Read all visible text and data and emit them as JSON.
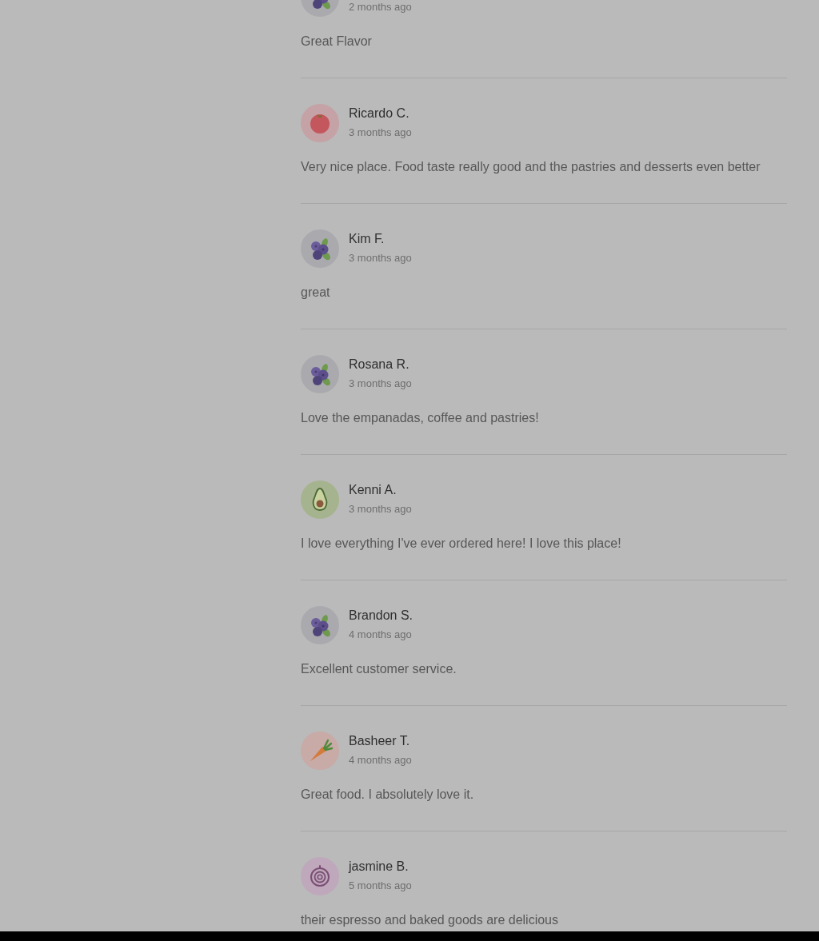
{
  "reviews": [
    {
      "avatar": {
        "kind": "blueberry"
      },
      "date": "2 months ago",
      "text": "Great Flavor"
    },
    {
      "avatar": {
        "kind": "tomato"
      },
      "name": "Ricardo C.",
      "date": "3 months ago",
      "text": "Very nice place. Food taste really good and the pastries and desserts even better"
    },
    {
      "avatar": {
        "kind": "blueberry"
      },
      "name": "Kim F.",
      "date": "3 months ago",
      "text": "great"
    },
    {
      "avatar": {
        "kind": "blueberry"
      },
      "name": "Rosana R.",
      "date": "3 months ago",
      "text": "Love the empanadas, coffee and pastries!"
    },
    {
      "avatar": {
        "kind": "avocado"
      },
      "name": "Kenni A.",
      "date": "3 months ago",
      "text": "I love everything I've ever ordered here! I love this place!"
    },
    {
      "avatar": {
        "kind": "blueberry"
      },
      "name": "Brandon S.",
      "date": "4 months ago",
      "text": "Excellent customer service."
    },
    {
      "avatar": {
        "kind": "carrot"
      },
      "name": "Basheer T.",
      "date": "4 months ago",
      "text": "Great food. I absolutely love it."
    },
    {
      "avatar": {
        "kind": "onion"
      },
      "name": "jasmine B.",
      "date": "5 months ago",
      "text": "their espresso and baked goods are delicious"
    }
  ]
}
